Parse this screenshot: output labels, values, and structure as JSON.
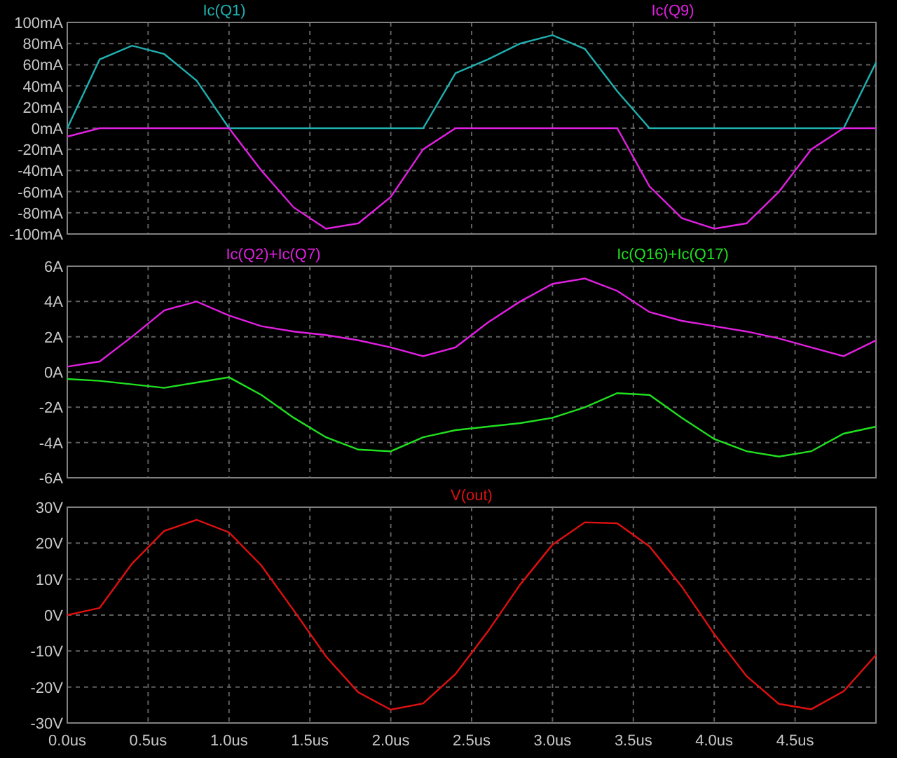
{
  "panels": [
    {
      "chart_data": {
        "type": "line",
        "x": [
          0,
          0.2,
          0.4,
          0.6,
          0.8,
          1.0,
          1.2,
          1.4,
          1.6,
          1.8,
          2.0,
          2.2,
          2.4,
          2.6,
          2.8,
          3.0,
          3.2,
          3.4,
          3.6,
          3.8,
          4.0,
          4.2,
          4.4,
          4.6,
          4.8,
          5.0
        ],
        "xlim": [
          0,
          5
        ],
        "ylim": [
          -100,
          100
        ],
        "series": [
          {
            "name": "Ic(Q1)",
            "color": "#20b0b0",
            "values": [
              0,
              65,
              78,
              70,
              45,
              0,
              0,
              0,
              0,
              0,
              0,
              0,
              52,
              65,
              80,
              88,
              75,
              35,
              0,
              0,
              0,
              0,
              0,
              0,
              0,
              62
            ]
          },
          {
            "name": "Ic(Q9)",
            "color": "#e020e0",
            "values": [
              -8,
              0,
              0,
              0,
              0,
              0,
              -40,
              -75,
              -95,
              -90,
              -65,
              -20,
              0,
              0,
              0,
              0,
              0,
              0,
              -55,
              -85,
              -95,
              -90,
              -60,
              -20,
              0,
              0
            ]
          }
        ],
        "grid": true,
        "yticks": [
          {
            "value": 100,
            "label": "100mA"
          },
          {
            "value": 80,
            "label": "80mA"
          },
          {
            "value": 60,
            "label": "60mA"
          },
          {
            "value": 40,
            "label": "40mA"
          },
          {
            "value": 20,
            "label": "20mA"
          },
          {
            "value": 0,
            "label": "0mA"
          },
          {
            "value": -20,
            "label": "-20mA"
          },
          {
            "value": -40,
            "label": "-40mA"
          },
          {
            "value": -60,
            "label": "-60mA"
          },
          {
            "value": -80,
            "label": "-80mA"
          },
          {
            "value": -100,
            "label": "-100mA"
          }
        ]
      }
    },
    {
      "chart_data": {
        "type": "line",
        "x": [
          0,
          0.2,
          0.4,
          0.6,
          0.8,
          1.0,
          1.2,
          1.4,
          1.6,
          1.8,
          2.0,
          2.2,
          2.4,
          2.6,
          2.8,
          3.0,
          3.2,
          3.4,
          3.6,
          3.8,
          4.0,
          4.2,
          4.4,
          4.6,
          4.8,
          5.0
        ],
        "xlim": [
          0,
          5
        ],
        "ylim": [
          -6,
          6
        ],
        "series": [
          {
            "name": "Ic(Q2)+Ic(Q7)",
            "color": "#e020e0",
            "values": [
              0.3,
              0.6,
              2.0,
              3.5,
              4.0,
              3.2,
              2.6,
              2.3,
              2.1,
              1.8,
              1.4,
              0.9,
              1.4,
              2.8,
              4.0,
              5.0,
              5.3,
              4.6,
              3.4,
              2.9,
              2.6,
              2.3,
              1.9,
              1.4,
              0.9,
              1.8
            ]
          },
          {
            "name": "Ic(Q16)+Ic(Q17)",
            "color": "#20e020",
            "values": [
              -0.4,
              -0.5,
              -0.7,
              -0.9,
              -0.6,
              -0.3,
              -1.3,
              -2.6,
              -3.7,
              -4.4,
              -4.5,
              -3.7,
              -3.3,
              -3.1,
              -2.9,
              -2.6,
              -2.0,
              -1.2,
              -1.3,
              -2.6,
              -3.8,
              -4.5,
              -4.8,
              -4.5,
              -3.5,
              -3.1
            ]
          }
        ],
        "grid": true,
        "yticks": [
          {
            "value": 6,
            "label": "6A"
          },
          {
            "value": 4,
            "label": "4A"
          },
          {
            "value": 2,
            "label": "2A"
          },
          {
            "value": 0,
            "label": "0A"
          },
          {
            "value": -2,
            "label": "-2A"
          },
          {
            "value": -4,
            "label": "-4A"
          },
          {
            "value": -6,
            "label": "-6A"
          }
        ]
      }
    },
    {
      "chart_data": {
        "type": "line",
        "x": [
          0,
          0.2,
          0.4,
          0.6,
          0.8,
          1.0,
          1.2,
          1.4,
          1.6,
          1.8,
          2.0,
          2.2,
          2.4,
          2.6,
          2.8,
          3.0,
          3.2,
          3.4,
          3.6,
          3.8,
          4.0,
          4.2,
          4.4,
          4.6,
          4.8,
          5.0
        ],
        "xlim": [
          0,
          5
        ],
        "ylim": [
          -30,
          30
        ],
        "series": [
          {
            "name": "V(out)",
            "color": "#e01010",
            "values": [
              0,
              2.0,
              14.3,
              23.4,
              26.5,
              23.0,
              13.8,
              1.3,
              -11.5,
              -21.5,
              -26.3,
              -24.6,
              -16.4,
              -4.6,
              8.5,
              19.6,
              25.8,
              25.5,
              19.1,
              7.9,
              -5.3,
              -17.0,
              -24.7,
              -26.2,
              -21.2,
              -11.1
            ]
          }
        ],
        "xticks": [
          {
            "value": 0,
            "label": "0.0us"
          },
          {
            "value": 0.5,
            "label": "0.5us"
          },
          {
            "value": 1,
            "label": "1.0us"
          },
          {
            "value": 1.5,
            "label": "1.5us"
          },
          {
            "value": 2,
            "label": "2.0us"
          },
          {
            "value": 2.5,
            "label": "2.5us"
          },
          {
            "value": 3,
            "label": "3.0us"
          },
          {
            "value": 3.5,
            "label": "3.5us"
          },
          {
            "value": 4,
            "label": "4.0us"
          },
          {
            "value": 4.5,
            "label": "4.5us"
          }
        ],
        "grid": true,
        "yticks": [
          {
            "value": 30,
            "label": "30V"
          },
          {
            "value": 20,
            "label": "20V"
          },
          {
            "value": 10,
            "label": "10V"
          },
          {
            "value": 0,
            "label": "0V"
          },
          {
            "value": -10,
            "label": "-10V"
          },
          {
            "value": -20,
            "label": "-20V"
          },
          {
            "value": -30,
            "label": "-30V"
          }
        ]
      }
    }
  ]
}
